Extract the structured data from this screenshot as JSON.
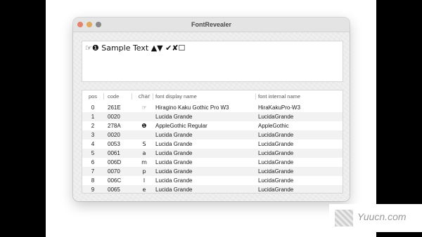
{
  "window": {
    "title": "FontRevealer"
  },
  "sample": {
    "text": "☞❶ Sample Text ▲▼ ✔✘☐"
  },
  "table": {
    "headers": {
      "pos": "pos",
      "code": "code",
      "char": "char",
      "display": "font display name",
      "internal": "font internal name"
    },
    "rows": [
      {
        "pos": "0",
        "code": "261E",
        "char": "☞",
        "display": "Hiragino Kaku Gothic Pro W3",
        "internal": "HiraKakuPro-W3"
      },
      {
        "pos": "1",
        "code": "0020",
        "char": "",
        "display": "Lucida Grande",
        "internal": "LucidaGrande"
      },
      {
        "pos": "2",
        "code": "278A",
        "char": "❶",
        "display": "AppleGothic Regular",
        "internal": "AppleGothic"
      },
      {
        "pos": "3",
        "code": "0020",
        "char": "",
        "display": "Lucida Grande",
        "internal": "LucidaGrande"
      },
      {
        "pos": "4",
        "code": "0053",
        "char": "S",
        "display": "Lucida Grande",
        "internal": "LucidaGrande"
      },
      {
        "pos": "5",
        "code": "0061",
        "char": "a",
        "display": "Lucida Grande",
        "internal": "LucidaGrande"
      },
      {
        "pos": "6",
        "code": "006D",
        "char": "m",
        "display": "Lucida Grande",
        "internal": "LucidaGrande"
      },
      {
        "pos": "7",
        "code": "0070",
        "char": "p",
        "display": "Lucida Grande",
        "internal": "LucidaGrande"
      },
      {
        "pos": "8",
        "code": "006C",
        "char": "l",
        "display": "Lucida Grande",
        "internal": "LucidaGrande"
      },
      {
        "pos": "9",
        "code": "0065",
        "char": "e",
        "display": "Lucida Grande",
        "internal": "LucidaGrande"
      }
    ]
  },
  "watermark": {
    "text": "Yuucn.com"
  },
  "colors": {
    "close": "#e3836b",
    "minimize": "#e1a95c",
    "zoom": "#8a8a8a"
  }
}
